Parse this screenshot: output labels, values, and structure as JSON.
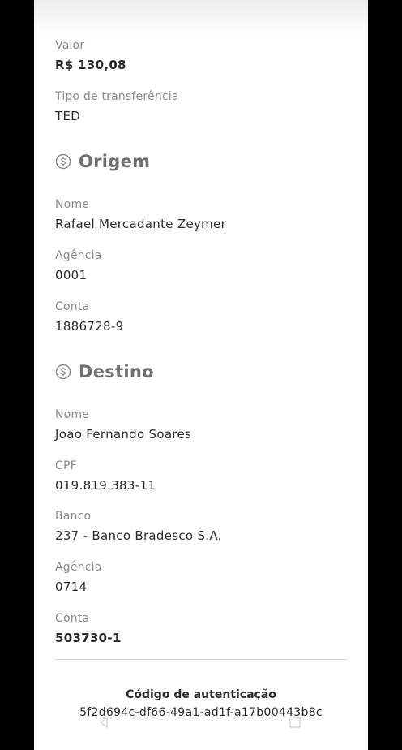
{
  "transfer": {
    "valor_label": "Valor",
    "valor_value": "R$ 130,08",
    "tipo_label": "Tipo de transferência",
    "tipo_value": "TED"
  },
  "origem": {
    "title": "Origem",
    "icon": "dollar-coin-icon",
    "nome_label": "Nome",
    "nome_value": "Rafael Mercadante Zeymer",
    "agencia_label": "Agência",
    "agencia_value": "0001",
    "conta_label": "Conta",
    "conta_value": "1886728-9"
  },
  "destino": {
    "title": "Destino",
    "icon": "dollar-coin-icon",
    "nome_label": "Nome",
    "nome_value": "Joao Fernando Soares",
    "cpf_label": "CPF",
    "cpf_value": "019.819.383-11",
    "banco_label": "Banco",
    "banco_value": "237 - Banco Bradesco S.A.",
    "agencia_label": "Agência",
    "agencia_value": "0714",
    "conta_label": "Conta",
    "conta_value": "503730-1"
  },
  "auth": {
    "title": "Código de autenticação",
    "code": "5f2d694c-df66-49a1-ad1f-a17b00443b8c"
  }
}
